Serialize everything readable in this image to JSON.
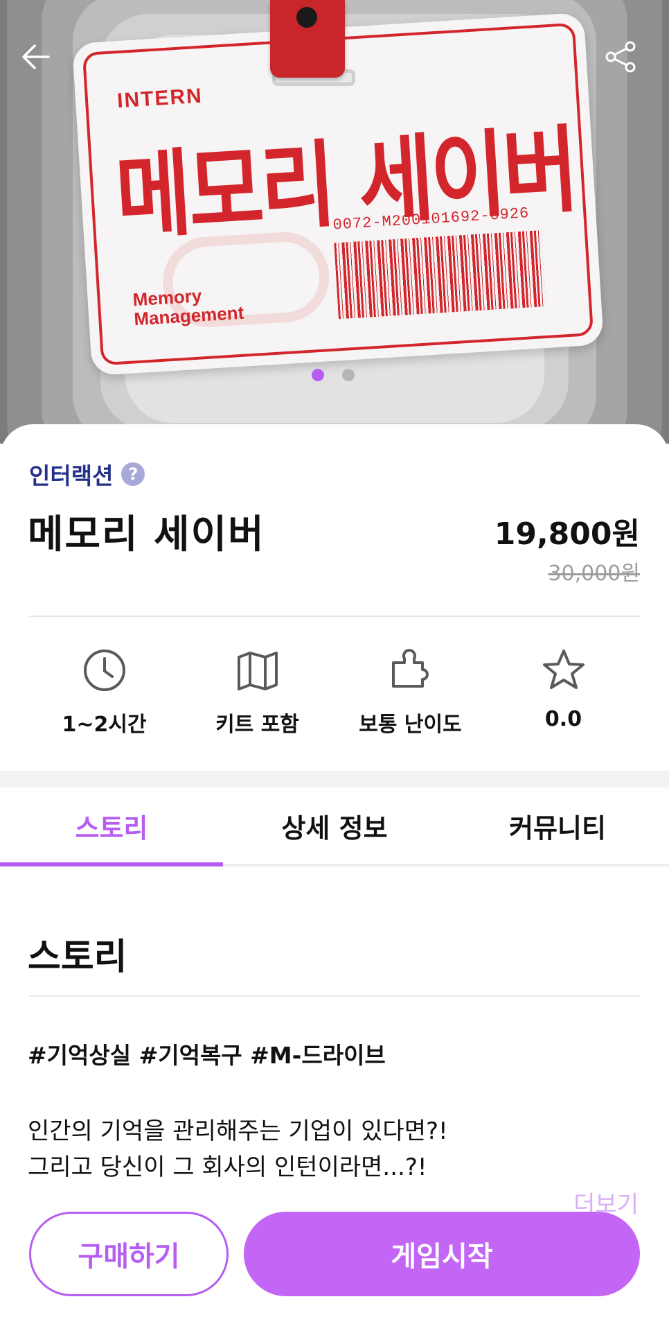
{
  "hero": {
    "badge_intern": "INTERN",
    "badge_title": "메모리 세이버",
    "badge_serial": "0072-M200101692-0926",
    "badge_brand_line1": "Memory",
    "badge_brand_line2": "Management",
    "slides_total": 2,
    "slide_active": 1
  },
  "product": {
    "category": "인터랙션",
    "title": "메모리 세이버",
    "price": "19,800원",
    "original_price": "30,000원"
  },
  "stats": [
    {
      "icon": "clock-icon",
      "label": "1~2시간"
    },
    {
      "icon": "map-icon",
      "label": "키트 포함"
    },
    {
      "icon": "puzzle-icon",
      "label": "보통 난이도"
    },
    {
      "icon": "star-icon",
      "label": "0.0"
    }
  ],
  "tabs": [
    {
      "label": "스토리",
      "active": true
    },
    {
      "label": "상세 정보",
      "active": false
    },
    {
      "label": "커뮤니티",
      "active": false
    }
  ],
  "story": {
    "heading": "스토리",
    "tags": "#기억상실 #기억복구 #M-드라이브",
    "line1": "인간의 기억을 관리해주는 기업이 있다면?!",
    "line2": "그리고 당신이 그 회사의 인턴이라면...?!",
    "more": "더보기"
  },
  "actions": {
    "buy": "구매하기",
    "start": "게임시작"
  },
  "colors": {
    "accent": "#b65df2",
    "category": "#24308a",
    "badge_red": "#d3262c"
  }
}
